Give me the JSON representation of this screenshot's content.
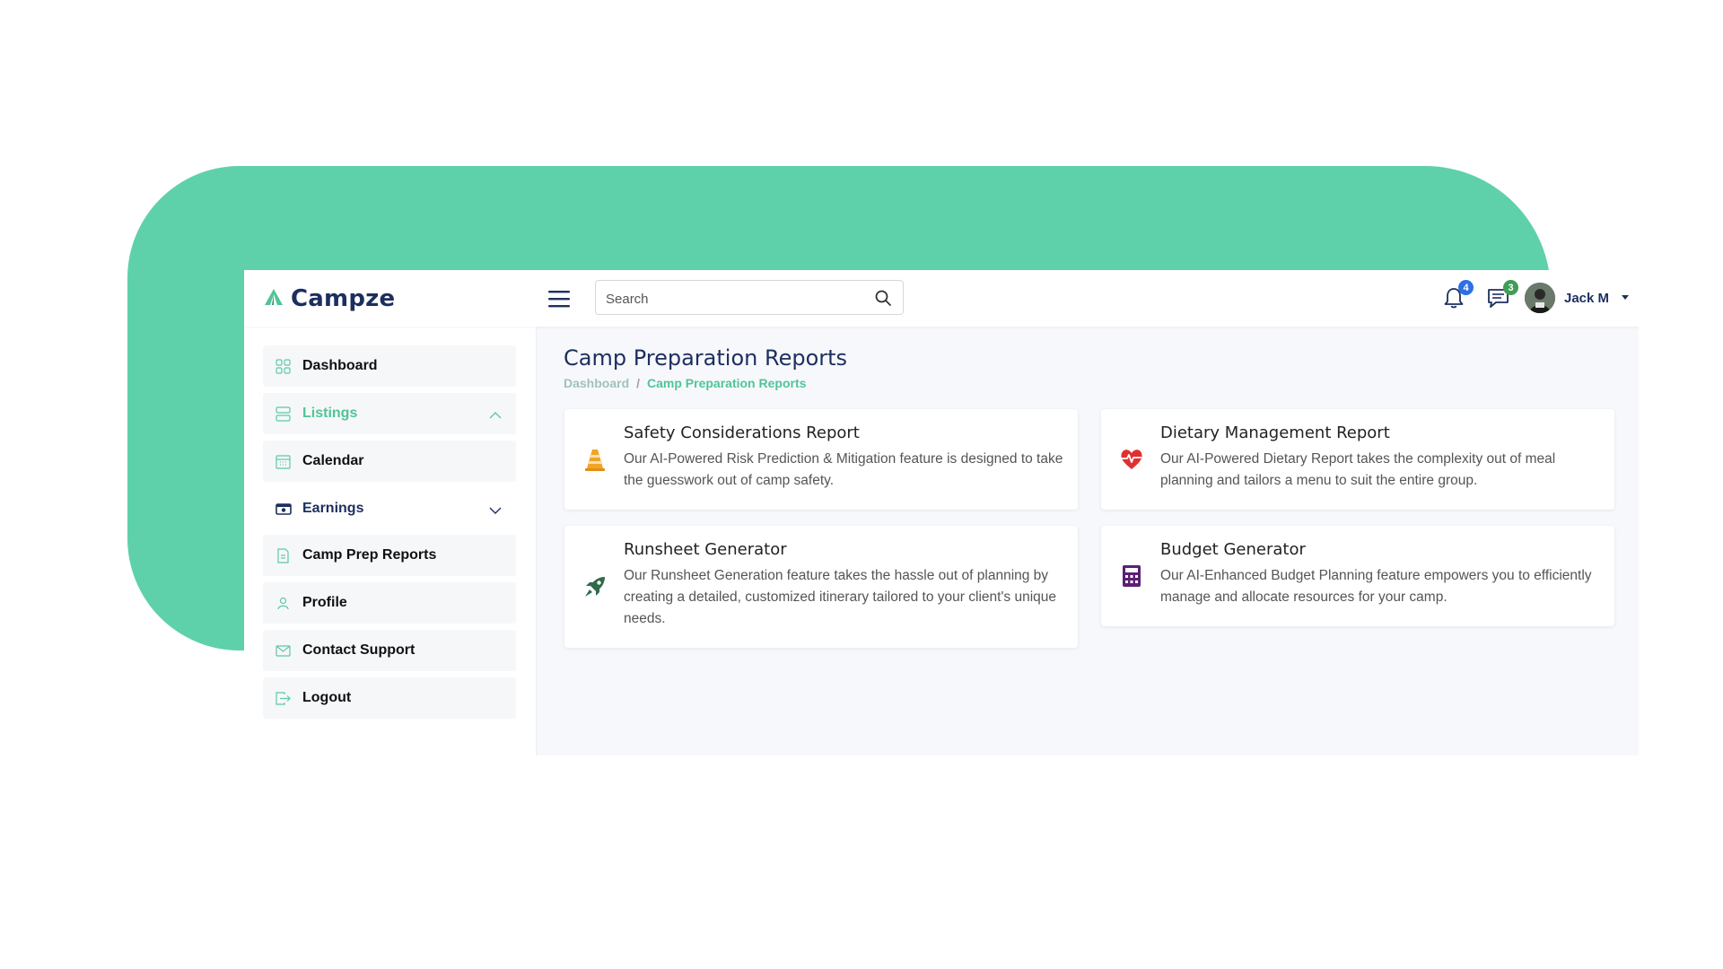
{
  "brand": {
    "name": "Campze",
    "logo_icon": "tent-icon",
    "color": "#1c2f5e",
    "accent": "#4fc596"
  },
  "header": {
    "menu_icon": "hamburger-icon",
    "search": {
      "placeholder": "Search",
      "value": ""
    },
    "notifications": {
      "icon": "bell-icon",
      "count": "4"
    },
    "messages": {
      "icon": "chat-icon",
      "count": "3"
    },
    "user": {
      "name": "Jack M",
      "avatar": "avatar"
    }
  },
  "sidebar": {
    "items": [
      {
        "label": "Dashboard",
        "icon": "grid-icon"
      },
      {
        "label": "Listings",
        "icon": "server-icon",
        "active": true,
        "expanded": true
      },
      {
        "label": "Calendar",
        "icon": "calendar-icon"
      },
      {
        "label": "Earnings",
        "icon": "money-icon",
        "expanded": false
      },
      {
        "label": "Camp Prep Reports",
        "icon": "document-icon"
      },
      {
        "label": "Profile",
        "icon": "user-icon"
      },
      {
        "label": "Contact Support",
        "icon": "mail-icon"
      },
      {
        "label": "Logout",
        "icon": "logout-icon"
      }
    ]
  },
  "page": {
    "title": "Camp Preparation Reports",
    "breadcrumb": {
      "home": "Dashboard",
      "separator": "/",
      "current": "Camp Preparation Reports"
    }
  },
  "cards": [
    {
      "title": "Safety Considerations Report",
      "description": "Our AI-Powered Risk Prediction & Mitigation feature is designed to take the guesswork out of camp safety.",
      "icon": "traffic-cone-icon",
      "color": "#f0a429"
    },
    {
      "title": "Dietary Management Report",
      "description": "Our AI-Powered Dietary Report takes the complexity out of meal planning and tailors a menu to suit the entire group.",
      "icon": "heartbeat-icon",
      "color": "#e03131"
    },
    {
      "title": "Runsheet Generator",
      "description": "Our Runsheet Generation feature takes the hassle out of planning by creating a detailed, customized itinerary tailored to your client's unique needs.",
      "icon": "rocket-icon",
      "color": "#2e6b4a"
    },
    {
      "title": "Budget Generator",
      "description": "Our AI-Enhanced Budget Planning feature empowers you to efficiently manage and allocate resources for your camp.",
      "icon": "calculator-icon",
      "color": "#5b1f75"
    }
  ]
}
